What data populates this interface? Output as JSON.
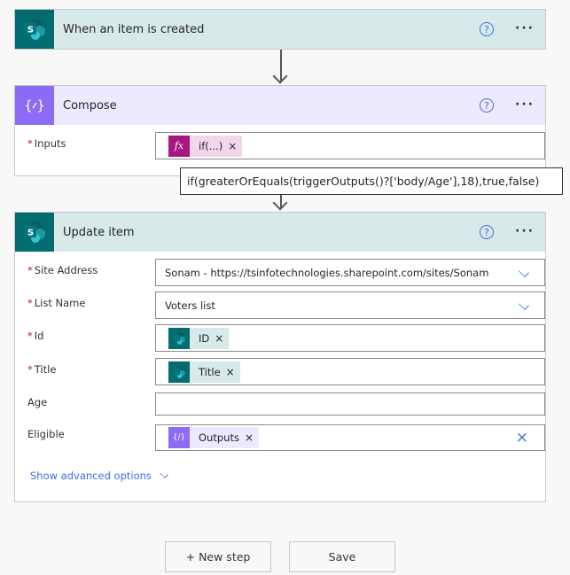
{
  "trigger": {
    "title": "When an item is created",
    "icon": "sharepoint-icon"
  },
  "compose": {
    "title": "Compose",
    "icon": "compose-braces-icon",
    "inputs_label": "Inputs",
    "inputs_token": {
      "label": "if(...)",
      "icon": "fx-icon",
      "remove": "×"
    }
  },
  "tooltip": {
    "text": "if(greaterOrEquals(triggerOutputs()?['body/Age'],18),true,false)"
  },
  "update_item": {
    "title": "Update item",
    "icon": "sharepoint-icon",
    "fields": {
      "site_address": {
        "label": "Site Address",
        "required": true,
        "value": "Sonam - https://tsinfotechnologies.sharepoint.com/sites/Sonam"
      },
      "list_name": {
        "label": "List Name",
        "required": true,
        "value": "Voters list"
      },
      "id": {
        "label": "Id",
        "required": true,
        "token": "ID",
        "remove": "×"
      },
      "title": {
        "label": "Title",
        "required": true,
        "token": "Title",
        "remove": "×"
      },
      "age": {
        "label": "Age",
        "required": false,
        "value": ""
      },
      "eligible": {
        "label": "Eligible",
        "required": false,
        "token": "Outputs",
        "remove": "×",
        "clear": "×"
      }
    },
    "advanced_options": "Show advanced options"
  },
  "common": {
    "required_marker": "*",
    "help": "?",
    "more": "···"
  },
  "actions": {
    "new_step": "+ New step",
    "save": "Save"
  },
  "colors": {
    "sharepoint": "#036c70",
    "sharepoint_header": "#d8e9e9",
    "compose": "#8c6cf5",
    "compose_header": "#ede9fe",
    "expression": "#a5177e",
    "expression_token_bg": "#f3d6ec",
    "accent": "#3b6fe6",
    "required": "#a4262c"
  }
}
